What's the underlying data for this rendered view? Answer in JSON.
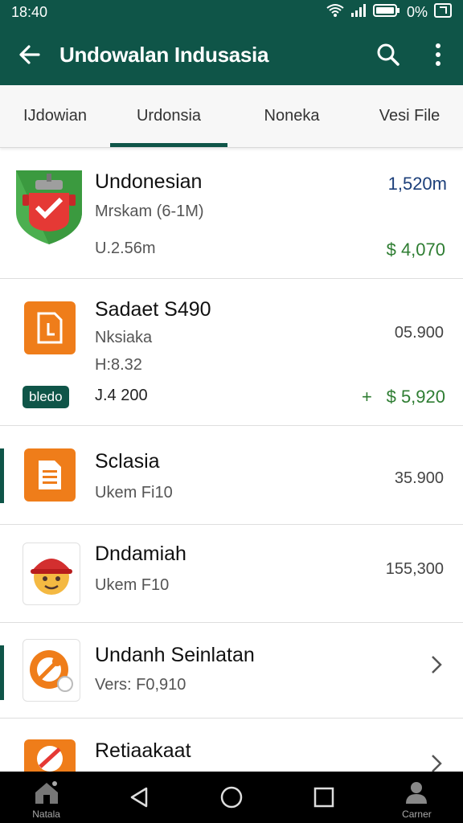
{
  "status": {
    "time": "18:40",
    "battery": "0%"
  },
  "appbar": {
    "title": "Undowalan Indusasia"
  },
  "tabs": [
    {
      "label": "IJdowian"
    },
    {
      "label": "Urdonsia"
    },
    {
      "label": "Noneka"
    },
    {
      "label": "Vesi File"
    }
  ],
  "items": [
    {
      "name": "Undonesian",
      "sub1": "Mrskam (6-1M)",
      "sub2": "U.2.56m",
      "value_top": "1,520m",
      "value_bottom": "$ 4,070"
    },
    {
      "name": "Sadaet S490",
      "sub1": "Nksiaka",
      "sub2": "H:8.32",
      "badge": "bledo",
      "amount": "J.4 200",
      "plus": "+",
      "value_top": "05.900",
      "value_bottom": "$ 5,920"
    },
    {
      "name": "Sclasia",
      "sub1": "Ukem Fi10",
      "value_top": "35.900"
    },
    {
      "name": "Dndamiah",
      "sub1": "Ukem F10",
      "value_top": "155,300"
    },
    {
      "name": "Undanh Seinlatan",
      "sub1": "Vers: F0,910"
    },
    {
      "name": "Retiaakaat"
    }
  ],
  "nav": {
    "home_label": "Natala",
    "profile_label": "Carner"
  }
}
